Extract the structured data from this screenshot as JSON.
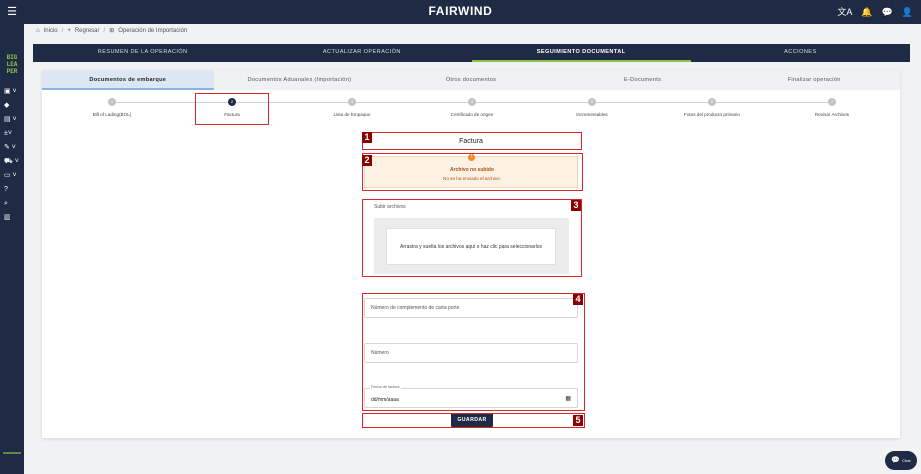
{
  "app": {
    "brand": "FAIRWIND"
  },
  "topbar": {
    "menu_icon": "hamburger-icon",
    "icons": [
      "translate-icon",
      "bell-icon",
      "message-icon",
      "account-icon"
    ],
    "translate_glyph": "文A",
    "bell_glyph": "🔔",
    "message_glyph": "💬",
    "account_glyph": "👤"
  },
  "sidebar": {
    "logo_lines": [
      "BIG",
      "LEA",
      "PER"
    ],
    "items": [
      {
        "icon": "ship-icon",
        "glyph": "▣ ˅"
      },
      {
        "icon": "tag-icon",
        "glyph": "◆"
      },
      {
        "icon": "box-icon",
        "glyph": "▤ ˅"
      },
      {
        "icon": "calculator-icon",
        "glyph": "±˅"
      },
      {
        "icon": "edit-icon",
        "glyph": "✎ ˅"
      },
      {
        "icon": "truck-icon",
        "glyph": "⛟ ˅"
      },
      {
        "icon": "folder-icon",
        "glyph": "▭ ˅"
      },
      {
        "icon": "help-icon",
        "glyph": "?"
      },
      {
        "icon": "search-icon",
        "glyph": "⌕"
      },
      {
        "icon": "book-icon",
        "glyph": "▥"
      }
    ]
  },
  "breadcrumb": {
    "home": "Inicio",
    "register": "Regresar",
    "current": "Operación de Importación"
  },
  "main_tabs": [
    {
      "label": "RESUMEN DE LA OPERACIÓN",
      "active": false
    },
    {
      "label": "ACTUALIZAR OPERACIÓN",
      "active": false
    },
    {
      "label": "SEGUIMIENTO DOCUMENTAL",
      "active": true
    },
    {
      "label": "ACCIONES",
      "active": false
    }
  ],
  "sub_tabs": [
    {
      "label": "Documentos de embarque",
      "active": true
    },
    {
      "label": "Documentos Aduanales (Importación)",
      "active": false
    },
    {
      "label": "Otros documentos",
      "active": false
    },
    {
      "label": "E-Documents",
      "active": false
    },
    {
      "label": "Finalizar operación",
      "active": false
    }
  ],
  "steps": [
    {
      "num": "1",
      "label": "Bill of Lading(BOL)",
      "active": false
    },
    {
      "num": "2",
      "label": "Factura",
      "active": true
    },
    {
      "num": "3",
      "label": "Lista de Empaque",
      "active": false
    },
    {
      "num": "4",
      "label": "Certificado de origen",
      "active": false
    },
    {
      "num": "5",
      "label": "Incrementables",
      "active": false
    },
    {
      "num": "6",
      "label": "Fotos del producto primario",
      "active": false
    },
    {
      "num": "7",
      "label": "Revisar Archivos",
      "active": false
    }
  ],
  "document": {
    "title": "Factura",
    "alert_icon": "warning-icon",
    "alert_glyph": "!",
    "alert_title": "Archivo no subido",
    "alert_message": "No se ha enviado el archivo."
  },
  "upload": {
    "label": "Subir archivos",
    "dropzone_text": "Arrastra y suelta los archivos aquí o haz clic para seleccionarlos"
  },
  "form": {
    "complement_placeholder": "Número de complemento de carta porte",
    "number_placeholder": "Número",
    "date_label": "Fecha de factura",
    "date_value": "dd/mm/aaaa",
    "calendar_glyph": "▦",
    "save_label": "GUARDAR"
  },
  "annotations": [
    "1",
    "2",
    "3",
    "4",
    "5"
  ],
  "chat": {
    "label": "Chat",
    "glyph": "💬"
  },
  "colors": {
    "navy": "#1f2a44",
    "accent_green": "#8bc34a",
    "annotation_red": "#d62828"
  }
}
